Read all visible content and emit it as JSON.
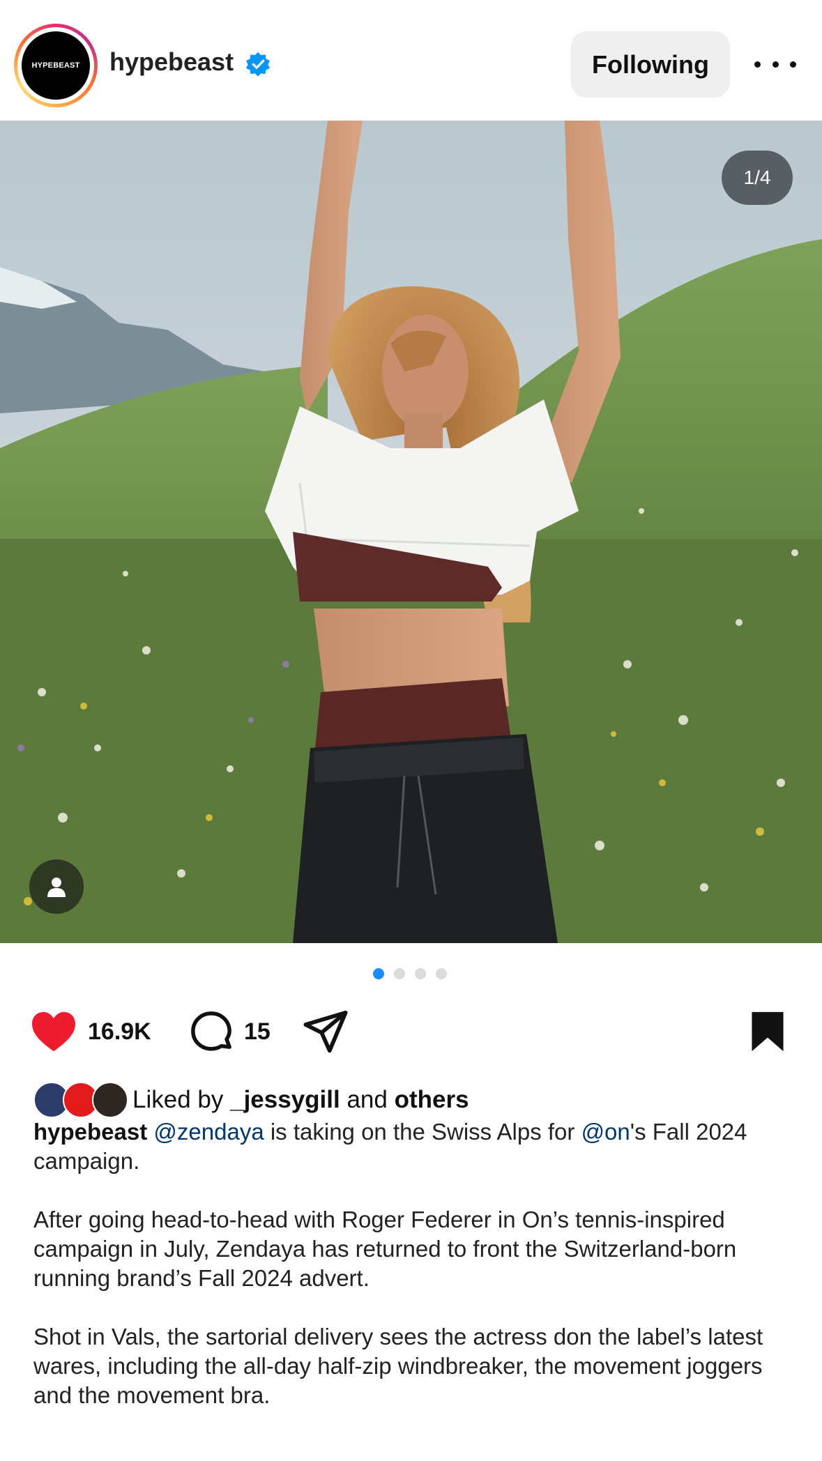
{
  "header": {
    "avatar_text": "HYPEBEAST",
    "username": "hypebeast",
    "follow_label": "Following"
  },
  "post": {
    "image_counter": "1/4",
    "total_images": 4,
    "active_image": 1
  },
  "actions": {
    "likes_count": "16.9K",
    "comments_count": "15",
    "liked": true,
    "saved": true
  },
  "likes": {
    "prefix": "Liked by",
    "user": "_jessygill",
    "conjunction": "and",
    "others": "others"
  },
  "caption": {
    "author": "hypebeast",
    "mention1": "@zendaya",
    "text1": " is taking on the Swiss Alps for ",
    "mention2": "@on",
    "text2": "'s Fall 2024 campaign.",
    "para2": "After going head-to-head with Roger Federer in On’s tennis-inspired campaign in July, Zendaya has returned to front the Switzerland-born running brand’s Fall 2024 advert.",
    "para3": "Shot in Vals, the sartorial delivery sees the actress don the label’s latest wares, including the all-day half-zip windbreaker, the movement joggers and the movement bra."
  },
  "colors": {
    "like": "#ed1c2e",
    "verified": "#0095f6",
    "dot_active": "#1a8cff",
    "mention": "#00376b"
  }
}
